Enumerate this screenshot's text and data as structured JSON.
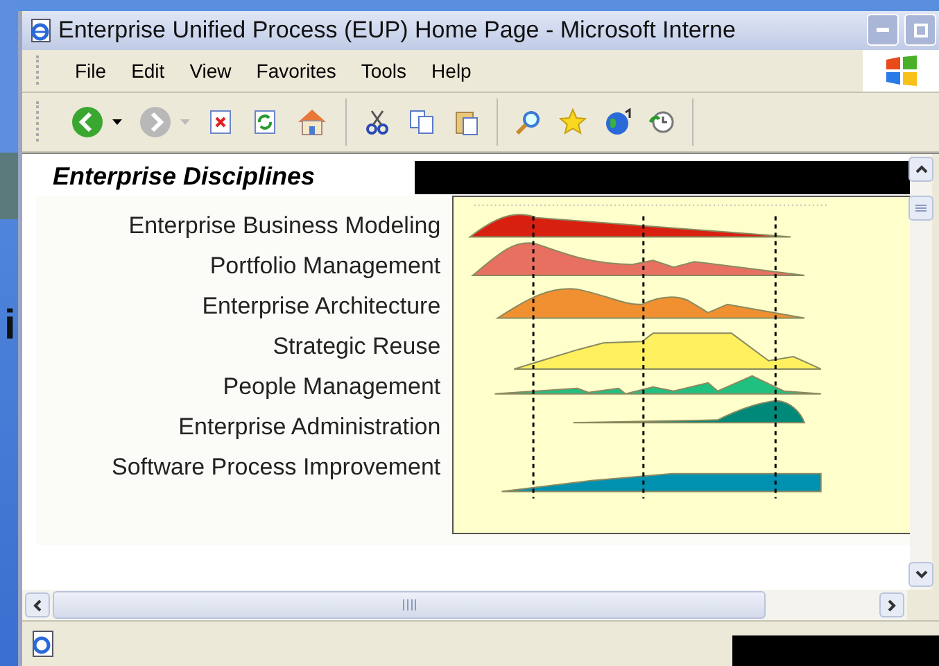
{
  "desktop": {
    "texts": [
      "i"
    ]
  },
  "window": {
    "title": "Enterprise Unified Process (EUP) Home Page - Microsoft Interne"
  },
  "menu": [
    "File",
    "Edit",
    "View",
    "Favorites",
    "Tools",
    "Help"
  ],
  "page": {
    "heading": "Enterprise Disciplines",
    "disciplines": [
      "Enterprise Business Modeling",
      "Portfolio Management",
      "Enterprise Architecture",
      "Strategic Reuse",
      "People Management",
      "Enterprise Administration",
      "Software Process Improvement"
    ]
  }
}
